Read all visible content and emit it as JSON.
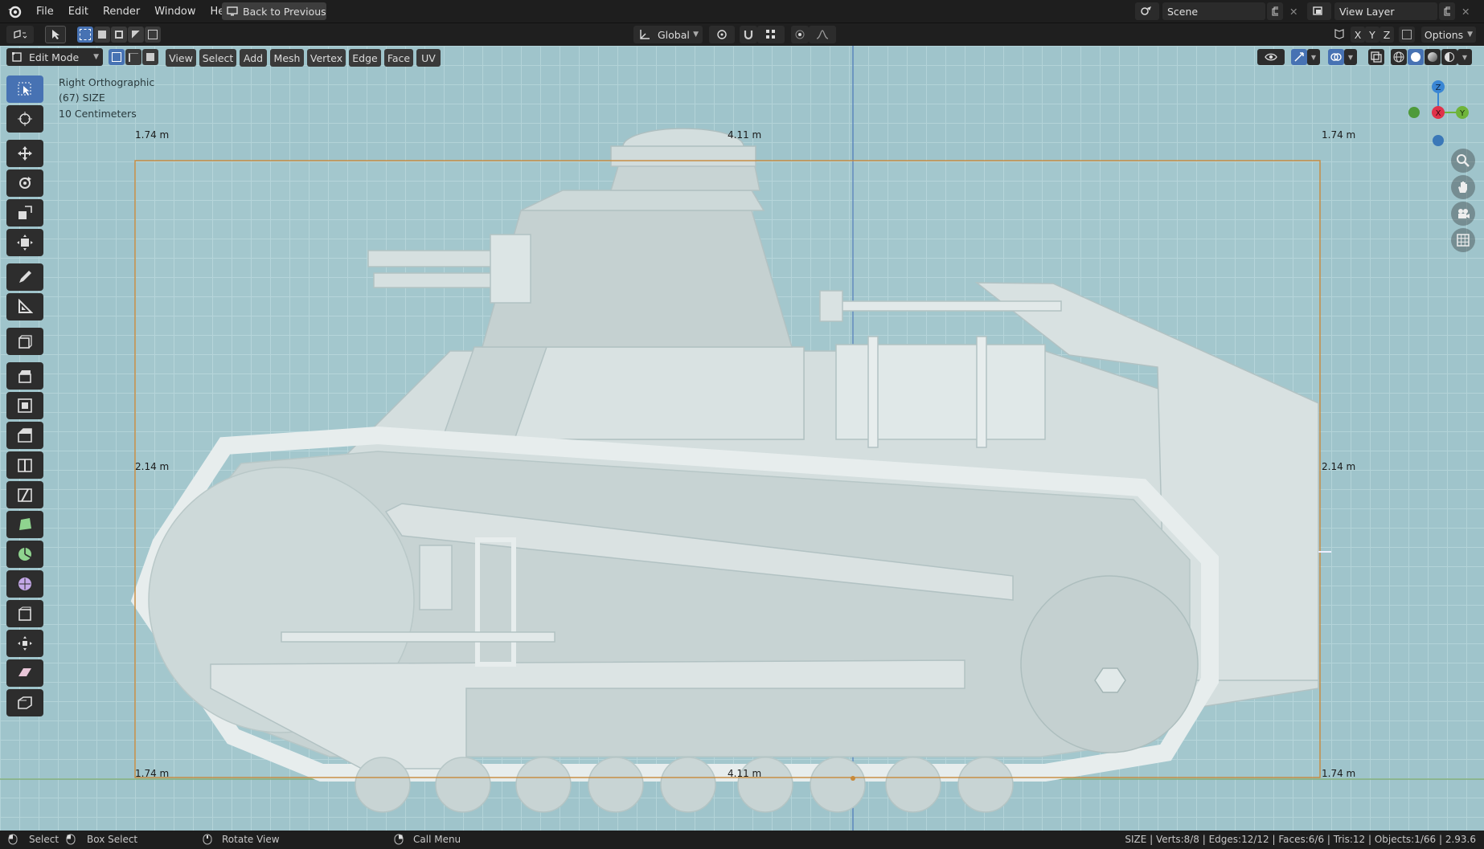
{
  "menu": [
    "File",
    "Edit",
    "Render",
    "Window",
    "Help"
  ],
  "back_button": "Back to Previous",
  "scene": {
    "label": "Scene",
    "view_layer": "View Layer"
  },
  "transform": {
    "orientation": "Global"
  },
  "header": {
    "mode": "Edit Mode",
    "menus": [
      "View",
      "Select",
      "Add",
      "Mesh",
      "Vertex",
      "Edge",
      "Face",
      "UV"
    ],
    "axes": [
      "X",
      "Y",
      "Z"
    ],
    "options": "Options"
  },
  "overlay": {
    "view_name": "Right Orthographic",
    "object_info": "(67) SIZE",
    "grid_scale": "10 Centimeters"
  },
  "dimensions": {
    "width": "4.11 m",
    "height": "2.14 m",
    "corner": "1.74 m"
  },
  "gizmo": {
    "z": "Z",
    "x": "X",
    "y": "Y"
  },
  "status": {
    "select": "Select",
    "box_select": "Box Select",
    "rotate": "Rotate View",
    "call_menu": "Call Menu",
    "stats": "SIZE | Verts:8/8 | Edges:12/12 | Faces:6/6 | Tris:12 | Objects:1/66 | 2.93.6"
  },
  "colors": {
    "accent": "#4772b3",
    "viewport": "#9fc4cb",
    "bbox": "#c8893a",
    "axis_x": "#e0324a",
    "axis_y": "#6fb43a",
    "axis_z": "#3a86d4"
  }
}
